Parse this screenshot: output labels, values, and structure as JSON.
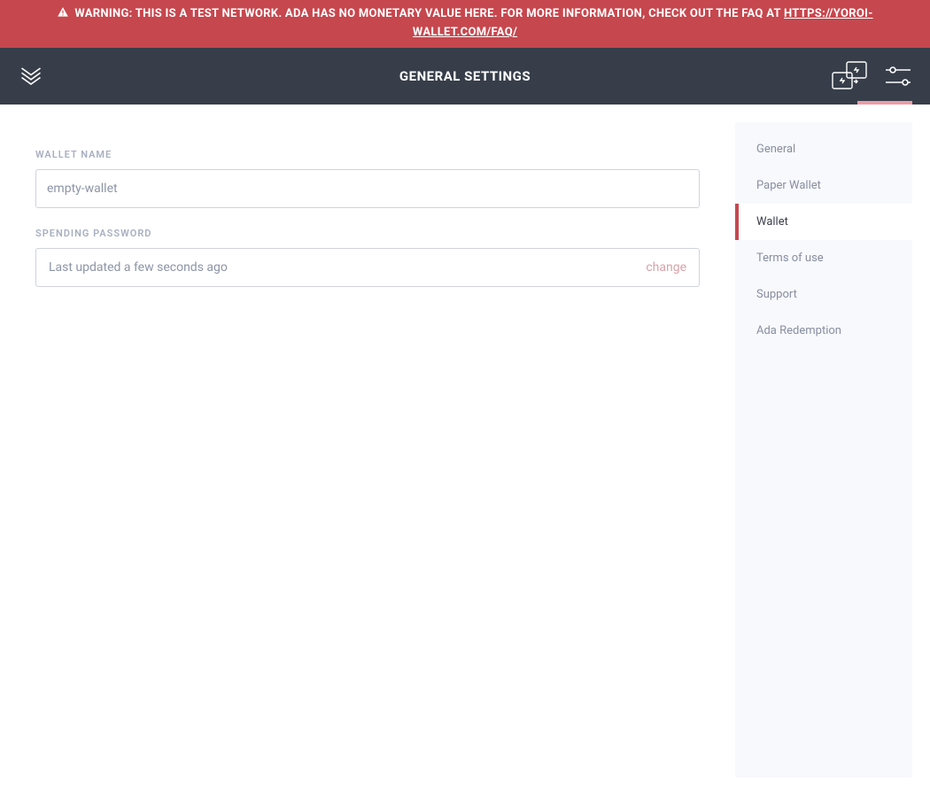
{
  "banner": {
    "text_before": "WARNING: THIS IS A TEST NETWORK. ADA HAS NO MONETARY VALUE HERE. FOR MORE INFORMATION, CHECK OUT THE FAQ AT ",
    "link_text": "HTTPS://YOROI-WALLET.COM/FAQ/"
  },
  "header": {
    "title": "GENERAL SETTINGS"
  },
  "form": {
    "wallet_name_label": "WALLET NAME",
    "wallet_name_value": "empty-wallet",
    "spending_password_label": "SPENDING PASSWORD",
    "spending_password_status": "Last updated a few seconds ago",
    "change_label": "change"
  },
  "sidebar": {
    "items": [
      {
        "label": "General",
        "active": false
      },
      {
        "label": "Paper Wallet",
        "active": false
      },
      {
        "label": "Wallet",
        "active": true
      },
      {
        "label": "Terms of use",
        "active": false
      },
      {
        "label": "Support",
        "active": false
      },
      {
        "label": "Ada Redemption",
        "active": false
      }
    ]
  }
}
